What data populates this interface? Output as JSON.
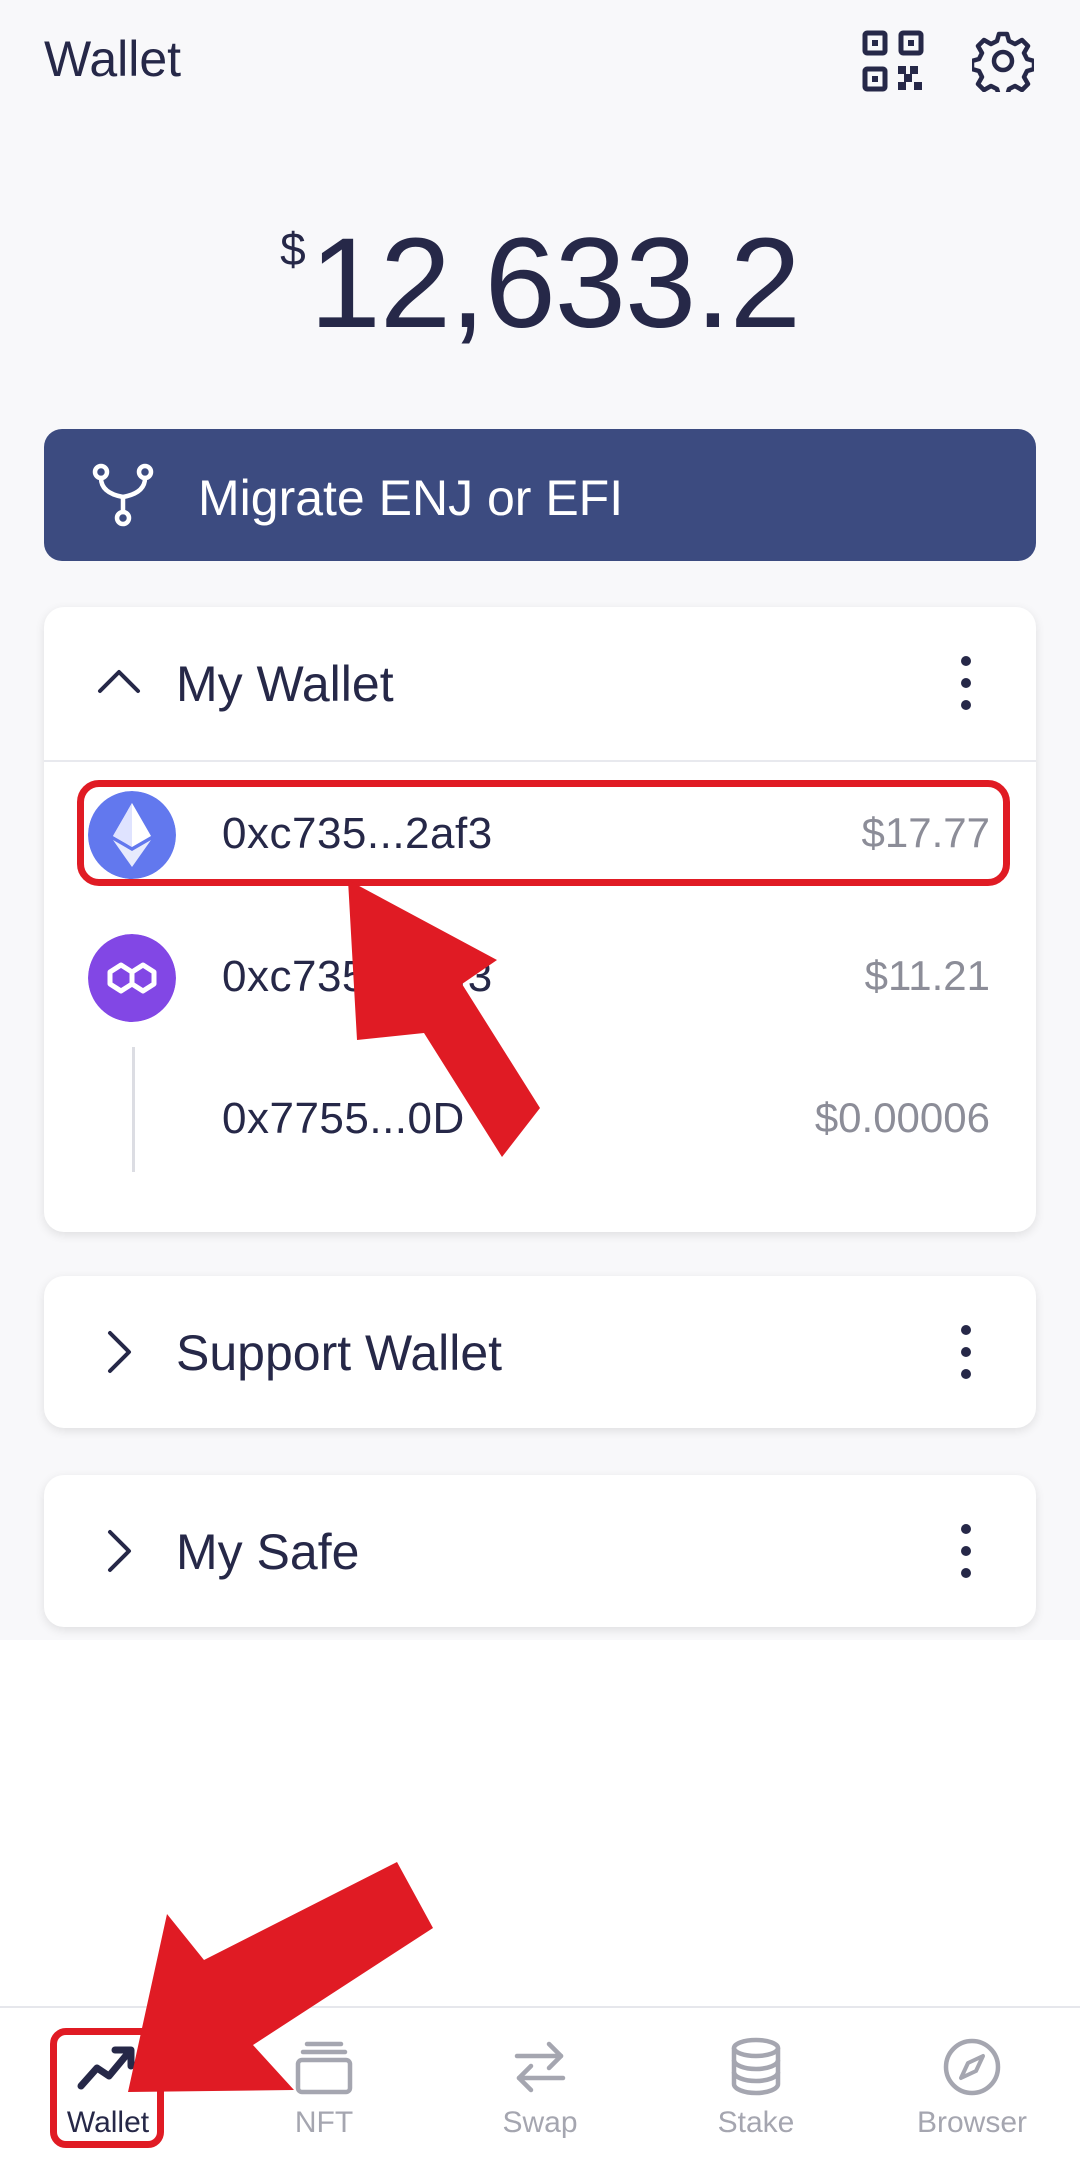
{
  "header": {
    "title": "Wallet",
    "qr_icon": "qr-code-icon",
    "settings_icon": "gear-icon"
  },
  "balance": {
    "currency_symbol": "$",
    "amount": "12,633.2"
  },
  "migrate": {
    "label": "Migrate ENJ or EFI",
    "icon": "fork-icon"
  },
  "wallets": [
    {
      "name": "My Wallet",
      "expanded": true,
      "accounts": [
        {
          "token_icon": "ethereum-icon",
          "address": "0xc735...2af3",
          "value": "$17.77"
        },
        {
          "token_icon": "polygon-icon",
          "address": "0xc735...2af3",
          "value": "$11.21"
        },
        {
          "token_icon": "",
          "address": "0x7755...0D",
          "value": "$0.00006"
        }
      ]
    },
    {
      "name": "Support Wallet",
      "expanded": false
    },
    {
      "name": "My Safe",
      "expanded": false
    }
  ],
  "nav": [
    {
      "label": "Wallet",
      "icon": "trending-up-icon",
      "active": true
    },
    {
      "label": "NFT",
      "icon": "cards-icon",
      "active": false
    },
    {
      "label": "Swap",
      "icon": "swap-arrows-icon",
      "active": false
    },
    {
      "label": "Stake",
      "icon": "coin-stack-icon",
      "active": false
    },
    {
      "label": "Browser",
      "icon": "compass-icon",
      "active": false
    }
  ],
  "colors": {
    "primary_text": "#262848",
    "migrate_bg": "#3c4b80",
    "ethereum": "#6278ee",
    "polygon": "#8247e5",
    "annotation_red": "#e01b24",
    "muted": "#a5a6b0"
  }
}
